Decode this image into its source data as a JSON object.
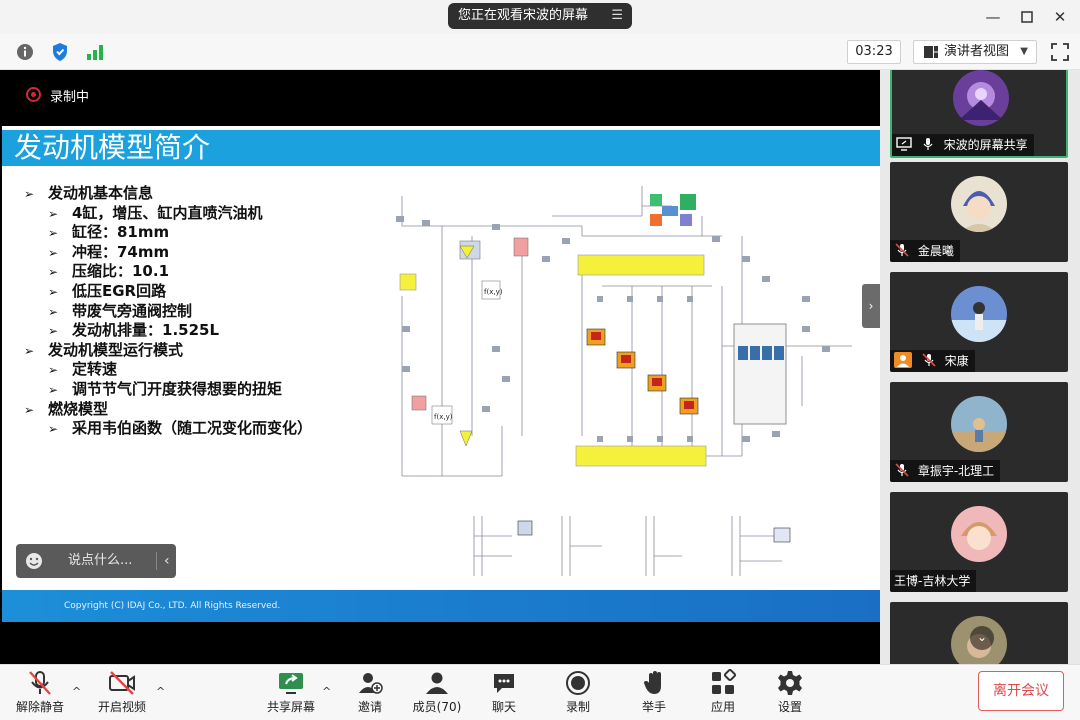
{
  "title_bar": {
    "sharing_notice": "您正在观看宋波的屏幕",
    "menu_icon": "hamburger-icon",
    "window_controls": [
      "minimize-icon",
      "maximize-icon",
      "close-icon"
    ]
  },
  "toolbar": {
    "left_icons": [
      "info-icon",
      "shield-icon",
      "signal-icon"
    ],
    "timer": "03:23",
    "view_mode": "演讲者视图",
    "fullscreen_icon": "fullscreen-icon"
  },
  "shared_screen": {
    "recording_label": "录制中",
    "slide": {
      "title": "发动机模型简介",
      "bullets": [
        {
          "level": 1,
          "text": "发动机基本信息"
        },
        {
          "level": 2,
          "text": "4缸，增压、缸内直喷汽油机"
        },
        {
          "level": 2,
          "text": "缸径：81mm"
        },
        {
          "level": 2,
          "text": "冲程：74mm"
        },
        {
          "level": 2,
          "text": "压缩比：10.1"
        },
        {
          "level": 2,
          "text": "低压EGR回路"
        },
        {
          "level": 2,
          "text": "带废气旁通阀控制"
        },
        {
          "level": 2,
          "text": "发动机排量：1.525L"
        },
        {
          "level": 1,
          "text": "发动机模型运行模式"
        },
        {
          "level": 2,
          "text": "定转速"
        },
        {
          "level": 2,
          "text": "调节节气门开度获得想要的扭矩"
        },
        {
          "level": 1,
          "text": "燃烧模型"
        },
        {
          "level": 2,
          "text": "采用韦伯函数（随工况变化而变化）"
        }
      ],
      "copyright": "Copyright (C)  IDAJ Co., LTD. All Rights Reserved."
    },
    "chat_input_placeholder": "说点什么..."
  },
  "participants": [
    {
      "name": "宋波的屏幕共享",
      "status": "sharing",
      "active": true,
      "avatar_color": "#6a3f9c"
    },
    {
      "name": "金晨曦",
      "status": "muted",
      "active": false,
      "avatar_color": "#d7c7a8"
    },
    {
      "name": "宋康",
      "status": "muted",
      "active": false,
      "avatar_color": "#6b8fd1",
      "host_badge": true
    },
    {
      "name": "章振宇-北理工",
      "status": "muted",
      "active": false,
      "avatar_color": "#8fb4cc"
    },
    {
      "name": "王博-吉林大学",
      "status": "none",
      "active": false,
      "avatar_color": "#f0b8b8"
    },
    {
      "name": "",
      "status": "none",
      "active": false,
      "avatar_color": "#888"
    }
  ],
  "bottom_bar": {
    "mute": "解除静音",
    "video": "开启视频",
    "share": "共享屏幕",
    "invite": "邀请",
    "members": "成员(70)",
    "chat": "聊天",
    "record": "录制",
    "raise_hand": "举手",
    "apps": "应用",
    "settings": "设置",
    "leave": "离开会议"
  },
  "colors": {
    "slide_title_bar": "#1aa1de",
    "recording_red": "#d12b2b",
    "leave_red": "#e04848",
    "active_tile_border": "#3cb371"
  }
}
